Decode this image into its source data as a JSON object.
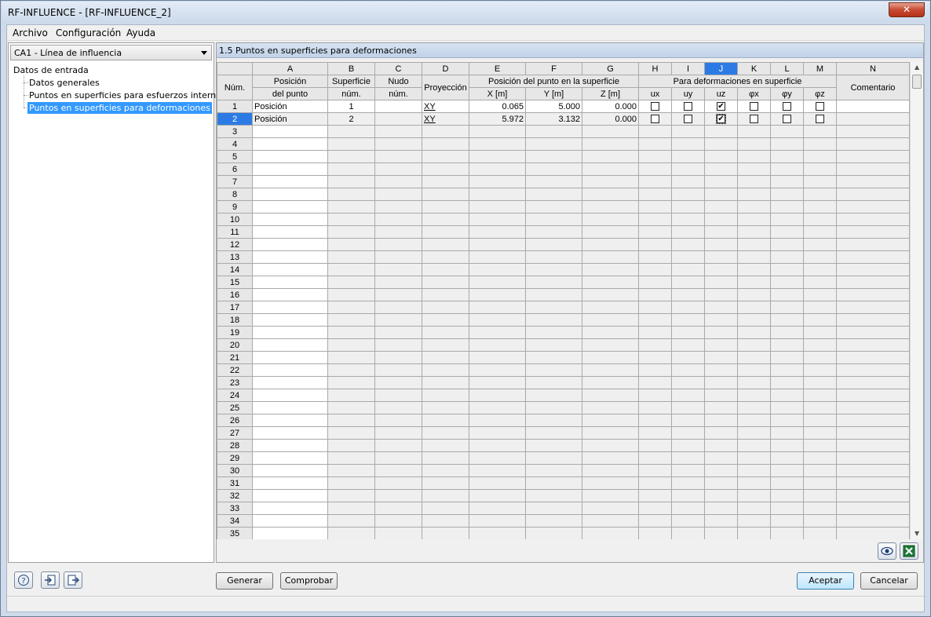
{
  "window": {
    "title": "RF-INFLUENCE - [RF-INFLUENCE_2]",
    "close_glyph": "✕"
  },
  "menu": [
    "Archivo",
    "Configuración",
    "Ayuda"
  ],
  "left": {
    "combo_value": "CA1 - Línea de influencia",
    "tree": {
      "root": "Datos de entrada",
      "items": [
        "Datos generales",
        "Puntos en superficies para esfuerzos internos",
        "Puntos en superficies para deformaciones"
      ]
    }
  },
  "panel": {
    "title": "1.5 Puntos en superficies para deformaciones"
  },
  "grid": {
    "col_letters": [
      "A",
      "B",
      "C",
      "D",
      "E",
      "F",
      "G",
      "H",
      "I",
      "J",
      "K",
      "L",
      "M",
      "N"
    ],
    "row_header": "Núm.",
    "headers": {
      "posicion_1": "Posición",
      "posicion_2": "del punto",
      "superficie_1": "Superficie",
      "superficie_2": "núm.",
      "nudo_1": "Nudo",
      "nudo_2": "núm.",
      "proyeccion": "Proyección",
      "pos_group": "Posición del punto en la superficie",
      "x": "X [m]",
      "y": "Y [m]",
      "z": "Z [m]",
      "def_group": "Para deformaciones en superficie",
      "ux": "ux",
      "uy": "uy",
      "uz": "uz",
      "px": "φx",
      "py": "φy",
      "pz": "φz",
      "comentario": "Comentario"
    },
    "rows": [
      {
        "num": "1",
        "posicion": "Posición",
        "superficie": "1",
        "nudo": "",
        "proyeccion": "XY",
        "x": "0.065",
        "y": "5.000",
        "z": "0.000",
        "checks": [
          false,
          false,
          true,
          false,
          false,
          false
        ],
        "comentario": ""
      },
      {
        "num": "2",
        "posicion": "Posición",
        "superficie": "2",
        "nudo": "",
        "proyeccion": "XY",
        "x": "5.972",
        "y": "3.132",
        "z": "0.000",
        "checks": [
          false,
          false,
          true,
          false,
          false,
          false
        ],
        "comentario": ""
      }
    ],
    "total_rows": 35
  },
  "icons": {
    "eye": "eye-icon",
    "excel": "excel-icon",
    "help": "help-icon",
    "import": "import-icon",
    "export": "export-icon"
  },
  "buttons": {
    "generar": "Generar",
    "comprobar": "Comprobar",
    "aceptar": "Aceptar",
    "cancelar": "Cancelar"
  },
  "colors": {
    "selection": "#3399ff",
    "selected_header": "#2c7be5",
    "titlebar": "#cbd9ea"
  }
}
